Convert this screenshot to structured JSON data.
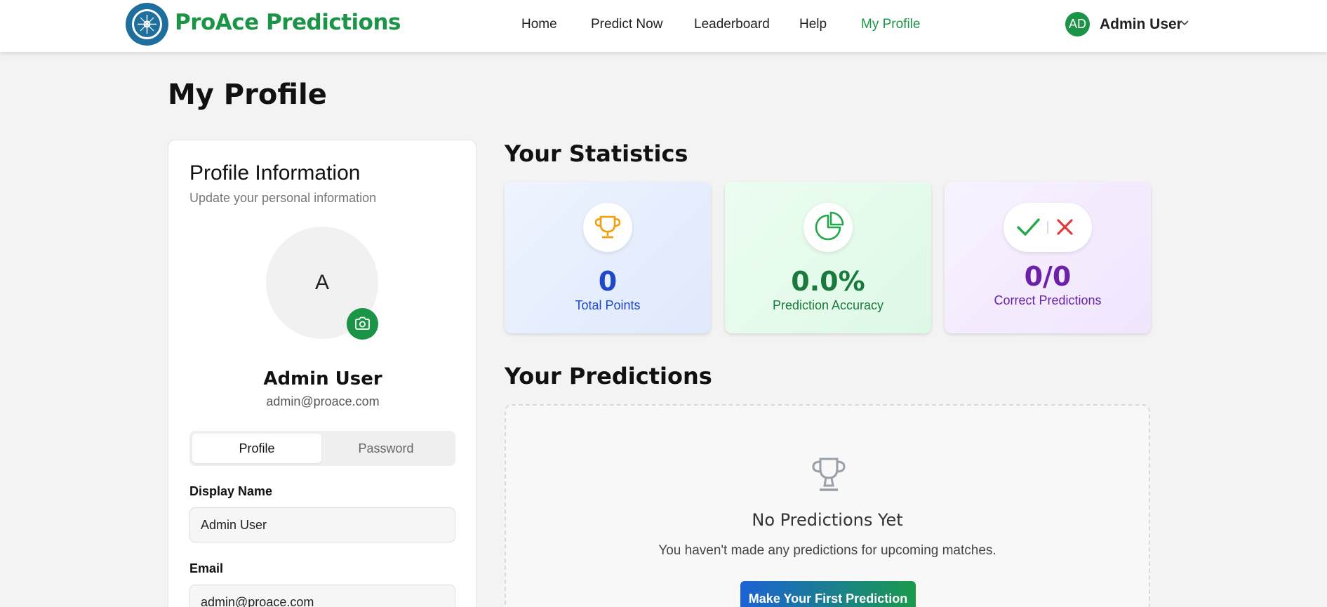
{
  "brand": {
    "name": "ProAce Predictions"
  },
  "nav": {
    "items": [
      "Home",
      "Predict Now",
      "Leaderboard",
      "Help",
      "My Profile"
    ],
    "active": "My Profile"
  },
  "user": {
    "initials": "AD",
    "name": "Admin User"
  },
  "page": {
    "title": "My Profile"
  },
  "profile_card": {
    "title": "Profile Information",
    "subtitle": "Update your personal information",
    "avatar_letter": "A",
    "name": "Admin User",
    "email": "admin@proace.com",
    "tabs": [
      "Profile",
      "Password"
    ],
    "active_tab": "Profile",
    "display_name_label": "Display Name",
    "display_name_value": "Admin User",
    "email_label": "Email",
    "email_value": "admin@proace.com"
  },
  "statistics": {
    "title": "Your Statistics",
    "cards": [
      {
        "value": "0",
        "label": "Total Points",
        "icon": "trophy-icon",
        "color": "#1e48c8"
      },
      {
        "value": "0.0%",
        "label": "Prediction Accuracy",
        "icon": "pie-chart-icon",
        "color": "#1a7a3c"
      },
      {
        "value": "0/0",
        "label": "Correct Predictions",
        "icon": "check-cross-icon",
        "color": "#6b21a8"
      }
    ]
  },
  "predictions": {
    "title": "Your Predictions",
    "empty_title": "No Predictions Yet",
    "empty_text": "You haven't made any predictions for upcoming matches.",
    "cta_label": "Make Your First Prediction"
  },
  "colors": {
    "brand_green": "#1c9447",
    "logo_blue": "#1f6f9e",
    "points_blue": "#1e48c8",
    "accuracy_green": "#1a7a3c",
    "correct_purple": "#6b21a8"
  }
}
